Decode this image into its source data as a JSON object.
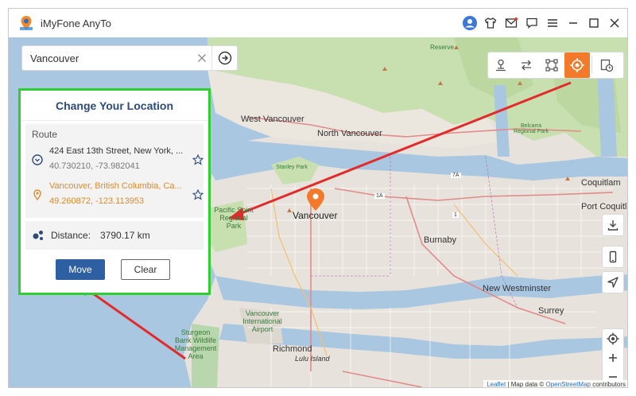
{
  "app": {
    "title": "iMyFone AnyTo"
  },
  "search": {
    "value": "Vancouver"
  },
  "panel": {
    "title": "Change Your Location",
    "route_label": "Route",
    "start": {
      "address": "424 East 13th Street, New York, ...",
      "coords": "40.730210, -73.982041"
    },
    "destination": {
      "address": "Vancouver, British Columbia, Ca...",
      "coords": "49.260872, -123.113953"
    },
    "distance_label": "Distance:",
    "distance_value": "3790.17 km",
    "move_label": "Move",
    "clear_label": "Clear"
  },
  "map_labels": {
    "reserve": "Reserve",
    "west_vancouver": "West Vancouver",
    "north_vancouver": "North Vancouver",
    "vancouver": "Vancouver",
    "burnaby": "Burnaby",
    "coquitlam": "Coquitlam",
    "port_coquitlam": "Port Coquitlam",
    "new_westminster": "New Westminster",
    "surrey": "Surrey",
    "richmond": "Richmond",
    "lulu_island": "Lulu Island",
    "pacific_spirit": "Pacific Spirit Regional Park",
    "vancouver_airport": "Vancouver International Airport",
    "sturgeon": "Sturgeon Bank Wildlife Management Area",
    "stanley_park": "Stanley Park",
    "belcarra": "Belcarra Regional Park",
    "highway_1a": "1A",
    "highway_7a": "7A",
    "highway_1": "1"
  },
  "attribution": {
    "leaflet": "Leaflet",
    "sep": "| Map data ©",
    "osm": "OpenStreetMap",
    "contrib": "contributors"
  },
  "colors": {
    "accent": "#f27a2a",
    "primary": "#2f5fa3",
    "highlight": "#2ecf2e",
    "arrow": "#e32b2b",
    "water": "#a9c7e0",
    "park": "#c8dfb0"
  }
}
